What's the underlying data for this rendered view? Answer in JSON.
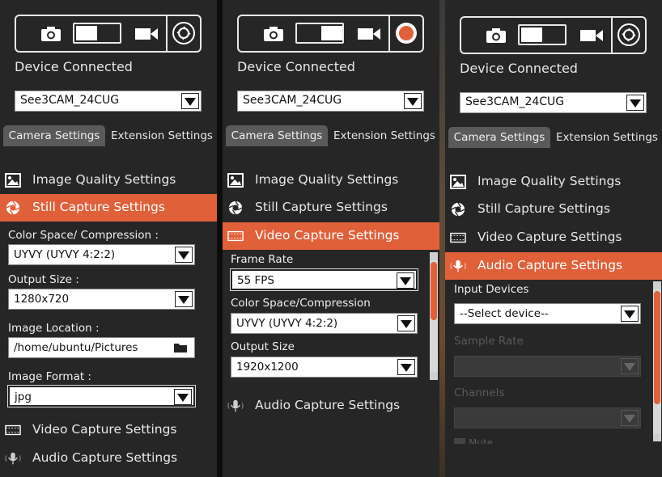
{
  "panels": [
    {
      "device_label": "Device Connected",
      "device_value": "See3CAM_24CUG",
      "tabs": [
        "Camera Settings",
        "Extension Settings"
      ],
      "menu": [
        {
          "label": "Image Quality Settings",
          "icon": "image-icon"
        },
        {
          "label": "Still Capture Settings",
          "icon": "aperture-icon",
          "active": true
        }
      ],
      "fields": [
        {
          "label": "Color Space/ Compression :",
          "value": "UYVY (UYVY 4:2:2)"
        },
        {
          "label": "Output Size :",
          "value": "1280x720"
        },
        {
          "label": "Image Location :",
          "value": "/home/ubuntu/Pictures"
        },
        {
          "label": "Image Format :",
          "value": "jpg"
        }
      ],
      "bottom_menu": [
        {
          "label": "Video Capture Settings",
          "icon": "film-icon"
        },
        {
          "label": "Audio Capture Settings",
          "icon": "microphone-icon"
        }
      ]
    },
    {
      "device_label": "Device Connected",
      "device_value": "See3CAM_24CUG",
      "tabs": [
        "Camera Settings",
        "Extension Settings"
      ],
      "menu": [
        {
          "label": "Image Quality Settings",
          "icon": "image-icon"
        },
        {
          "label": "Still Capture Settings",
          "icon": "aperture-icon"
        },
        {
          "label": "Video Capture Settings",
          "icon": "film-icon",
          "active": true
        }
      ],
      "fields": [
        {
          "label": "Frame Rate",
          "value": "55 FPS"
        },
        {
          "label": "Color Space/Compression",
          "value": "UYVY (UYVY 4:2:2)"
        },
        {
          "label": "Output Size",
          "value": "1920x1200"
        }
      ],
      "bottom_menu": [
        {
          "label": "Audio Capture Settings",
          "icon": "microphone-icon"
        }
      ]
    },
    {
      "device_label": "Device Connected",
      "device_value": "See3CAM_24CUG",
      "tabs": [
        "Camera Settings",
        "Extension Settings"
      ],
      "menu": [
        {
          "label": "Image Quality Settings",
          "icon": "image-icon"
        },
        {
          "label": "Still Capture Settings",
          "icon": "aperture-icon"
        },
        {
          "label": "Video Capture Settings",
          "icon": "film-icon"
        },
        {
          "label": "Audio Capture Settings",
          "icon": "microphone-icon",
          "active": true
        }
      ],
      "fields": [
        {
          "label": "Input Devices",
          "value": "--Select device--"
        },
        {
          "label": "Sample Rate",
          "value": ""
        },
        {
          "label": "Channels",
          "value": ""
        }
      ],
      "partial_label": "Mute"
    }
  ],
  "colors": {
    "accent": "#e0603a",
    "panel_bg": "#262626",
    "text": "#e8e8e8"
  }
}
